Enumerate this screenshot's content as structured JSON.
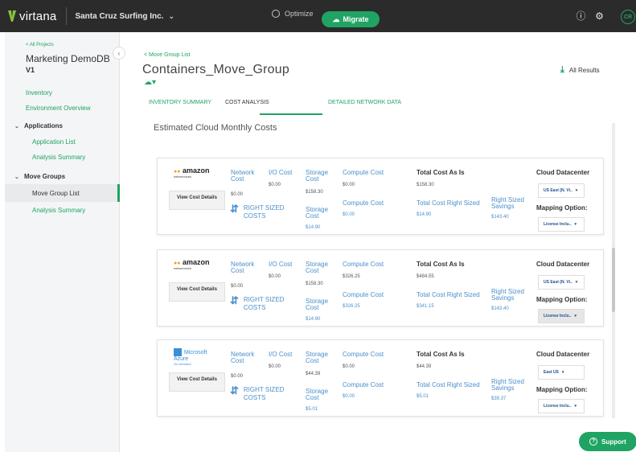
{
  "topbar": {
    "app_name": "virtana",
    "org_name": "Santa Cruz Surfing Inc.",
    "optimize_label": "Optimize",
    "migrate_label": "Migrate",
    "avatar_initials": "CR",
    "icons": [
      "logo-icon",
      "chevron-down-icon",
      "optimize-icon",
      "migrate-icon",
      "help-icon",
      "gear-icon"
    ]
  },
  "sidebar": {
    "back_link": "< All Projects",
    "project_name": "Marketing DemoDB",
    "project_version": "V1",
    "items": [
      {
        "label": "Inventory"
      },
      {
        "label": "Environment Overview"
      },
      {
        "label": "Applications"
      },
      {
        "label": "Application List"
      },
      {
        "label": "Analysis Summary"
      },
      {
        "label": "Move Groups"
      },
      {
        "label": "Move Group List"
      },
      {
        "label": "Analysis Summary"
      }
    ]
  },
  "main": {
    "breadcrumb": "< Move Group List",
    "title": "Containers_Move_Group",
    "all_results_label": "All Results",
    "tabs": [
      {
        "label": "INVENTORY SUMMARY"
      },
      {
        "label": "COST ANALYSIS"
      },
      {
        "label": "DETAILED NETWORK DATA"
      }
    ],
    "active_tab": "COST ANALYSIS",
    "section_title": "Estimated Cloud Monthly Costs"
  },
  "labels": {
    "view_cost_details": "View Cost Details",
    "network_cost": "Network Cost",
    "io_cost": "I/O Cost",
    "storage_cost": "Storage Cost",
    "compute_cost": "Compute Cost",
    "total_cost_as_is": "Total Cost As Is",
    "right_sized_costs": "RIGHT SIZED COSTS",
    "total_cost_right_sized": "Total Cost Right Sized",
    "right_sized_savings": "Right Sized Savings",
    "cloud_datacenter": "Cloud Datacenter",
    "mapping_option": "Mapping Option:"
  },
  "cards": [
    {
      "vendor": "amazon",
      "vendor_name": "amazon",
      "vendor_sub": "webservices",
      "network_cost": "$0.00",
      "io_cost": "$0.00",
      "storage_cost": "$158.30",
      "compute_cost": "$0.00",
      "total_as_is": "$158.30",
      "rs_storage": "$14.90",
      "rs_compute": "$0.00",
      "rs_total": "$14.90",
      "rs_savings": "$143.40",
      "datacenter": "US East (N. Vi..",
      "mapping": "License Inclu.."
    },
    {
      "vendor": "amazon",
      "vendor_name": "amazon",
      "vendor_sub": "webservices",
      "network_cost": "$0.00",
      "io_cost": "$0.00",
      "storage_cost": "$158.30",
      "compute_cost": "$326.25",
      "total_as_is": "$484.55",
      "rs_storage": "$14.90",
      "rs_compute": "$326.25",
      "rs_total": "$341.15",
      "rs_savings": "$143.40",
      "datacenter": "US East (N. Vi..",
      "mapping": "License Inclu.."
    },
    {
      "vendor": "azure",
      "vendor_name": "Microsoft Azure",
      "vendor_sub": "On Demand",
      "network_cost": "$0.00",
      "io_cost": "$0.00",
      "storage_cost": "$44.39",
      "compute_cost": "$0.00",
      "total_as_is": "$44.39",
      "rs_storage": "$5.01",
      "rs_compute": "$0.00",
      "rs_total": "$5.01",
      "rs_savings": "$39.37",
      "datacenter": "East US",
      "mapping": "License Inclu.."
    }
  ],
  "support_label": "Support",
  "colors": {
    "accent": "#1fa463",
    "link_blue": "#4a8fcb",
    "topbar": "#2b2b2b"
  }
}
